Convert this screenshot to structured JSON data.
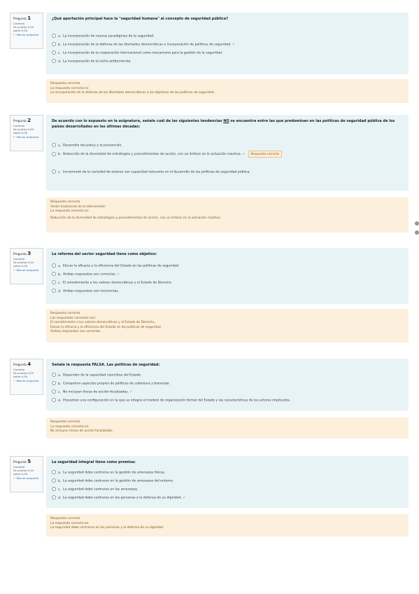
{
  "questions": [
    {
      "label": "Pregunta",
      "number": "1",
      "status": "Correcta",
      "score_line1": "Se puntúa 0,50",
      "score_line2": "sobre 0,50",
      "flag": "Marcar pregunta",
      "text": "¿Qué aportación principal hace la \"seguridad humana\" al concepto de seguridad pública?",
      "options": [
        {
          "letter": "a.",
          "text": "La incorporación de nuevos paradigmas de la seguridad.",
          "correct": false
        },
        {
          "letter": "b.",
          "text": "La incorporación de la defensa de las libertades democráticas e incorporación de políticas de seguridad.",
          "correct": true
        },
        {
          "letter": "c.",
          "text": "La incorporación de la cooperación internacional como mecanismo para la gestión de la seguridad.",
          "correct": false
        },
        {
          "letter": "d.",
          "text": "La incorporación de la lucha antiterrorista.",
          "correct": false
        }
      ],
      "feedback": [
        "Respuesta correcta",
        "La respuesta correcta es:",
        "La incorporación de la defensa de las libertades democráticas a los objetivos de las políticas de seguridad."
      ]
    },
    {
      "label": "Pregunta",
      "number": "2",
      "status": "Correcta",
      "score_line1": "Se puntúa 0,50",
      "score_line2": "sobre 0,50",
      "flag": "Marcar pregunta",
      "text_part1": "De acuerdo con lo expuesto en la asignatura, señale cuál de las siguientes tendencias ",
      "text_emph": "NO",
      "text_part2": " se encuentra entre las que predominan en las políticas de seguridad pública de los países desarrollados en las últimas décadas:",
      "options": [
        {
          "letter": "a.",
          "text": "Desarrollo del policy y la prevención.",
          "correct": false
        },
        {
          "letter": "b.",
          "text": "Reducción de la diversidad de estrategias y procedimientos de acción, con un énfasis en la actuación reactiva.",
          "correct": true,
          "tag": "Respuesta correcta"
        },
        {
          "letter": "c.",
          "text": "Incremento de la variedad de actores con capacidad relevante en el desarrollo de las políticas de seguridad pública.",
          "correct": false
        }
      ],
      "feedback": [
        "Respuesta correcta",
        "Visión tradicional de la intervención",
        "La respuesta correcta es:",
        "Reducción de la diversidad de estrategias y procedimientos de acción, con un énfasis en la actuación reactiva."
      ]
    },
    {
      "label": "Pregunta",
      "number": "3",
      "status": "Correcta",
      "score_line1": "Se puntúa 0,50",
      "score_line2": "sobre 0,50",
      "flag": "Marcar pregunta",
      "text": "La reforma del sector seguridad tiene como objetivo:",
      "options": [
        {
          "letter": "a.",
          "text": "Elevar la eficacia y la eficiencia del Estado en las políticas de seguridad.",
          "correct": false
        },
        {
          "letter": "b.",
          "text": "Ambas respuestas son correctas.",
          "correct": true
        },
        {
          "letter": "c.",
          "text": "El sometimiento a los valores democráticos y al Estado de Derecho.",
          "correct": false
        },
        {
          "letter": "d.",
          "text": "Ambas respuestas son incorrectas.",
          "correct": false
        }
      ],
      "feedback": [
        "Respuesta correcta",
        "Las respuestas correctas son:",
        "El sometimiento a los valores democráticos y al Estado de Derecho.,",
        "Elevar la eficacia y la eficiencia del Estado en las políticas de seguridad.",
        "Ambas respuestas son correctas."
      ]
    },
    {
      "label": "Pregunta",
      "number": "4",
      "status": "Correcta",
      "score_line1": "Se puntúa 0,50",
      "score_line2": "sobre 0,50",
      "flag": "Marcar pregunta",
      "text": "Señale la respuesta FALSA. Las políticas de seguridad:",
      "options": [
        {
          "letter": "a.",
          "text": "Dependen de la capacidad coercitiva del Estado.",
          "correct": false
        },
        {
          "letter": "b.",
          "text": "Comparten aspectos propios de políticas de cobertura y bienestar.",
          "correct": false
        },
        {
          "letter": "c.",
          "text": "No incluyen líneas de acción focalizadas.",
          "correct": true
        },
        {
          "letter": "d.",
          "text": "Presentan una configuración en la que se integra el modelo de organización formal del Estado y las características de los actores implicados.",
          "correct": false
        }
      ],
      "feedback": [
        "Respuesta correcta",
        "La respuesta correcta es:",
        "No incluyen líneas de acción focalizadas."
      ]
    },
    {
      "label": "Pregunta",
      "number": "5",
      "status": "Correcta",
      "score_line1": "Se puntúa 0,50",
      "score_line2": "sobre 0,50",
      "flag": "Marcar pregunta",
      "text": "La seguridad integral tiene como premisa:",
      "options": [
        {
          "letter": "a.",
          "text": "La seguridad debe centrarse en la gestión de amenazas físicas.",
          "correct": false
        },
        {
          "letter": "b.",
          "text": "La seguridad debe centrarse en la gestión de amenazas del entorno.",
          "correct": false
        },
        {
          "letter": "c.",
          "text": "La seguridad debe centrarse en las amenazas.",
          "correct": false
        },
        {
          "letter": "d.",
          "text": "La seguridad debe centrarse en las personas y la defensa de su dignidad.",
          "correct": true
        }
      ],
      "feedback": [
        "Respuesta correcta",
        "La respuesta correcta es:",
        "La seguridad debe centrarse en las personas y la defensa de su dignidad."
      ]
    }
  ],
  "check_mark": "✓",
  "colors": {
    "question_bg": "#e7f3f5",
    "feedback_bg": "#fcefdc",
    "correct": "#357a32"
  }
}
